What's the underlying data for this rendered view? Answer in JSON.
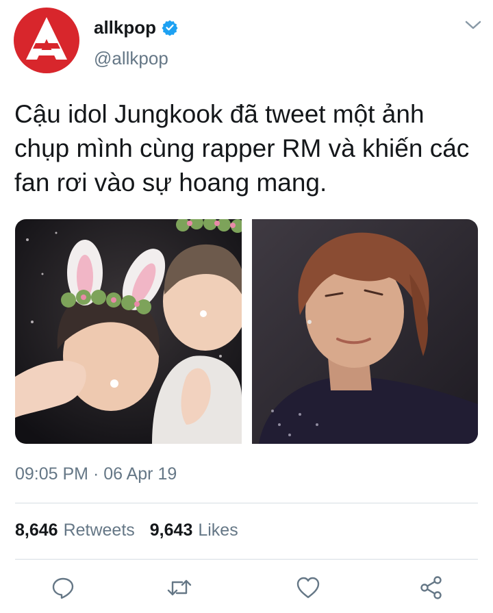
{
  "tweet": {
    "display_name": "allkpop",
    "handle": "@allkpop",
    "verified": true,
    "text": "Cậu idol Jungkook đã tweet một ảnh chụp mình cùng rapper RM và khiến các fan rơi vào sự hoang mang.",
    "timestamp": "09:05 PM · 06 Apr 19",
    "retweets_count": "8,646",
    "retweets_label": "Retweets",
    "likes_count": "9,643",
    "likes_label": "Likes"
  },
  "icons": {
    "avatar": "allkpop-logo",
    "verified": "verified-badge-icon",
    "menu": "chevron-down-icon",
    "actions": [
      "reply-icon",
      "retweet-icon",
      "like-icon",
      "share-icon"
    ]
  },
  "media": [
    "photo-left",
    "photo-right"
  ],
  "colors": {
    "brand_red": "#d8262c",
    "verified_blue": "#1da1f2",
    "secondary_text": "#657786",
    "primary_text": "#14171a",
    "divider": "#d6dde3"
  }
}
